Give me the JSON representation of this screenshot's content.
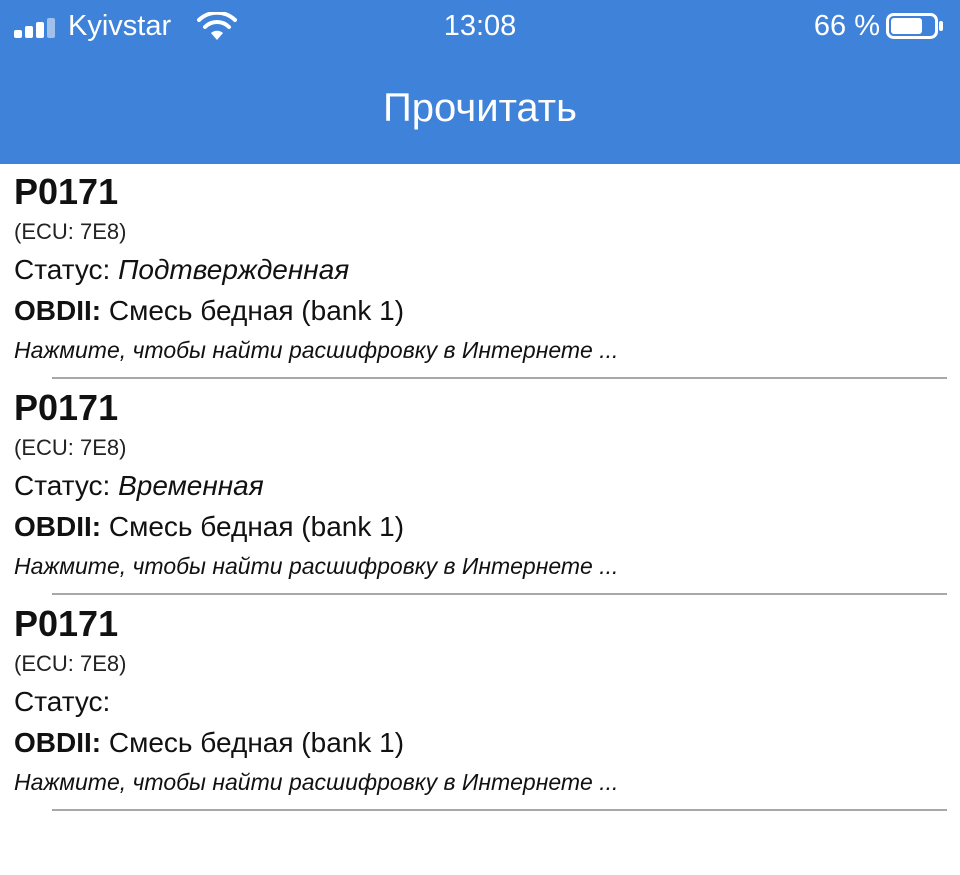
{
  "status_bar": {
    "carrier": "Kyivstar",
    "time": "13:08",
    "battery": "66 %"
  },
  "nav": {
    "title": "Прочитать"
  },
  "codes": [
    {
      "code": "P0171",
      "ecu": "(ECU: 7E8)",
      "status_label": "Статус:",
      "status_value": "Подтвержденная",
      "obd_label": "OBDII:",
      "obd_value": "Смесь бедная (bank 1)",
      "hint": "Нажмите, чтобы найти расшифровку в Интернете ..."
    },
    {
      "code": "P0171",
      "ecu": "(ECU: 7E8)",
      "status_label": "Статус:",
      "status_value": "Временная",
      "obd_label": "OBDII:",
      "obd_value": "Смесь бедная (bank 1)",
      "hint": "Нажмите, чтобы найти расшифровку в Интернете ..."
    },
    {
      "code": "P0171",
      "ecu": "(ECU: 7E8)",
      "status_label": "Статус:",
      "status_value": "",
      "obd_label": "OBDII:",
      "obd_value": "Смесь бедная (bank 1)",
      "hint": "Нажмите, чтобы найти расшифровку в Интернете ..."
    }
  ],
  "icons": {
    "signal": "cellular-signal-icon",
    "wifi": "wifi-icon",
    "battery": "battery-icon"
  },
  "colors": {
    "header_bg": "#3f82d9",
    "separator": "#a8a8a8"
  }
}
